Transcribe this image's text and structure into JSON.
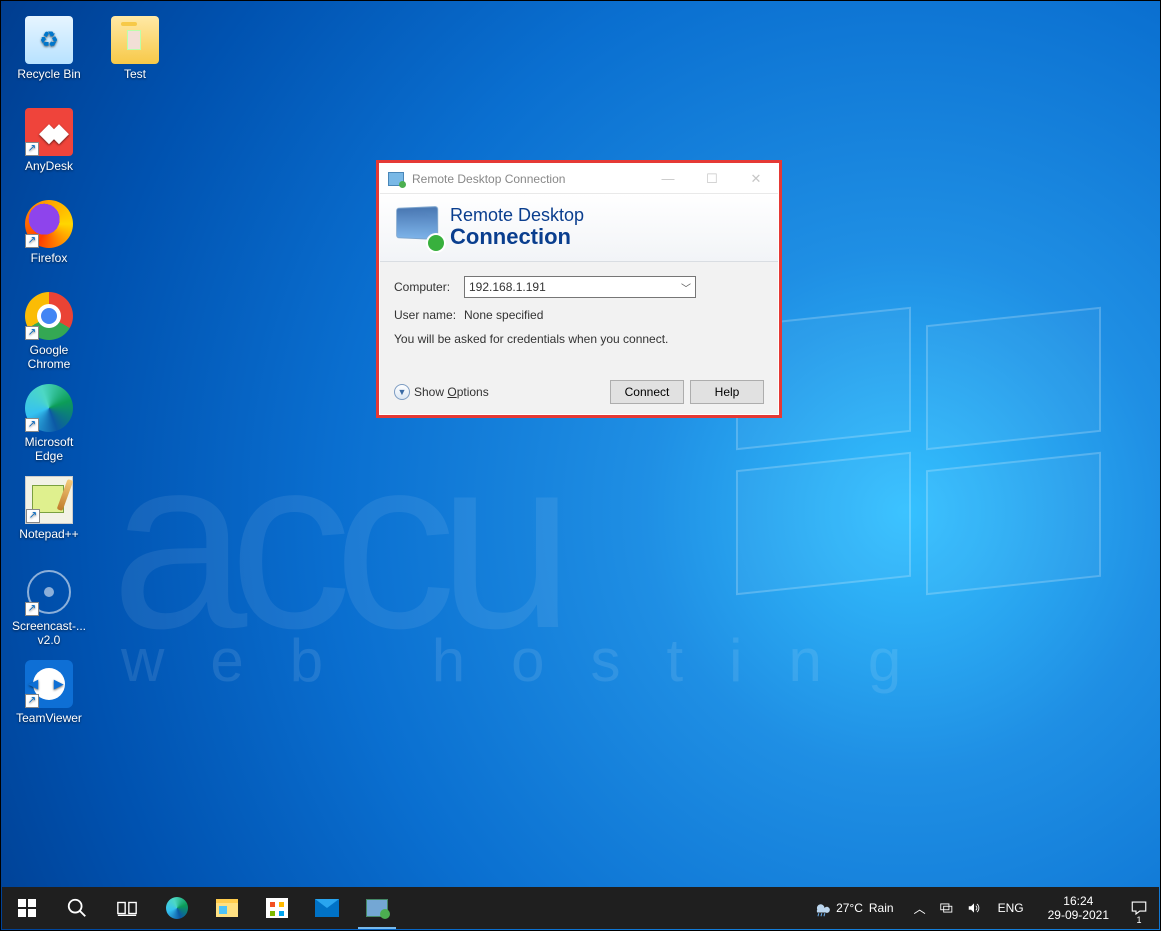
{
  "desktop": {
    "icons_col1": [
      {
        "label": "Recycle Bin",
        "icon": "recycle-bin",
        "shortcut": false
      },
      {
        "label": "AnyDesk",
        "icon": "anydesk",
        "shortcut": true
      },
      {
        "label": "Firefox",
        "icon": "firefox",
        "shortcut": true
      },
      {
        "label": "Google Chrome",
        "icon": "chrome",
        "shortcut": true
      },
      {
        "label": "Microsoft Edge",
        "icon": "edge",
        "shortcut": true
      },
      {
        "label": "Notepad++",
        "icon": "notepadpp",
        "shortcut": true
      },
      {
        "label": "Screencast-... v2.0",
        "icon": "screencast",
        "shortcut": true
      },
      {
        "label": "TeamViewer",
        "icon": "teamviewer",
        "shortcut": true
      }
    ],
    "icons_col2": [
      {
        "label": "Test",
        "icon": "folder",
        "shortcut": false
      }
    ]
  },
  "rdc": {
    "window_title": "Remote Desktop Connection",
    "banner_line1": "Remote Desktop",
    "banner_line2": "Connection",
    "computer_label": "Computer:",
    "computer_value": "192.168.1.191",
    "username_label": "User name:",
    "username_value": "None specified",
    "hint": "You will be asked for credentials when you connect.",
    "show_options_prefix": "Show ",
    "show_options_letter": "O",
    "show_options_suffix": "ptions",
    "connect": "Connect",
    "help": "Help"
  },
  "watermark": {
    "accu": "accu",
    "web": "web hosting"
  },
  "taskbar": {
    "weather_temp": "27°C",
    "weather_desc": "Rain",
    "lang": "ENG",
    "time": "16:24",
    "date": "29-09-2021",
    "notif_count": "1"
  }
}
